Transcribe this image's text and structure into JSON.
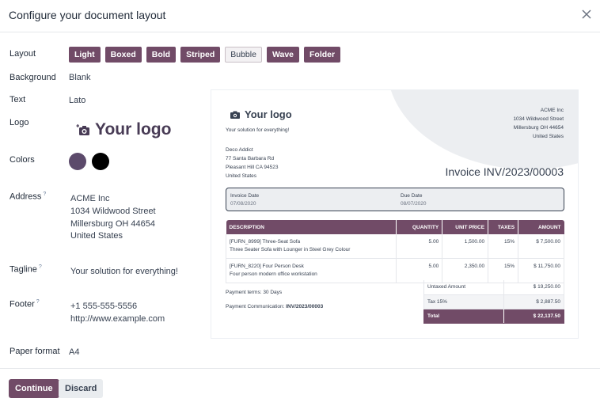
{
  "dialog": {
    "title": "Configure your document layout",
    "close_icon": "close-icon"
  },
  "fields": {
    "layout_label": "Layout",
    "layout_options": [
      "Light",
      "Boxed",
      "Bold",
      "Striped",
      "Bubble",
      "Wave",
      "Folder"
    ],
    "layout_selected": "Bubble",
    "background_label": "Background",
    "background_value": "Blank",
    "text_label": "Text",
    "text_value": "Lato",
    "logo_label": "Logo",
    "logo_text": "Your logo",
    "colors_label": "Colors",
    "colors": {
      "primary": "#5c4a6b",
      "secondary": "#000000"
    },
    "address_label": "Address",
    "address_help": "?",
    "address_lines": [
      "ACME Inc",
      "1034 Wildwood Street",
      "Millersburg OH 44654",
      "United States"
    ],
    "tagline_label": "Tagline",
    "tagline_help": "?",
    "tagline_value": "Your solution for everything!",
    "footer_label": "Footer",
    "footer_help": "?",
    "footer_lines": [
      "+1 555-555-5556",
      "http://www.example.com"
    ],
    "paper_label": "Paper format",
    "paper_value": "A4"
  },
  "preview": {
    "logo_text": "Your logo",
    "tagline": "Your solution for everything!",
    "company_lines": [
      "ACME Inc",
      "1034 Wildwood Street",
      "Millersburg OH 44654",
      "United States"
    ],
    "customer_lines": [
      "Deco Addict",
      "77 Santa Barbara Rd",
      "Pleasant Hill CA 94523",
      "United States"
    ],
    "invoice_title": "Invoice INV/2023/00003",
    "invoice_date_label": "Invoice Date",
    "invoice_date": "07/08/2020",
    "due_date_label": "Due Date",
    "due_date": "08/07/2020",
    "columns": [
      "DESCRIPTION",
      "QUANTITY",
      "UNIT PRICE",
      "TAXES",
      "AMOUNT"
    ],
    "rows": [
      {
        "code": "[FURN_8999] Three-Seat Sofa",
        "desc": "Three Seater Sofa with Lounger in Steel Grey Colour",
        "qty": "5.00",
        "price": "1,500.00",
        "tax": "15%",
        "amount": "$ 7,500.00"
      },
      {
        "code": "[FURN_8220] Four Person Desk",
        "desc": "Four person modern office workstation",
        "qty": "5.00",
        "price": "2,350.00",
        "tax": "15%",
        "amount": "$ 11,750.00"
      }
    ],
    "terms": "Payment terms: 30 Days",
    "communication_label": "Payment Communication: ",
    "communication_value": "INV/2023/00003",
    "totals": [
      {
        "label": "Untaxed Amount",
        "value": "$ 19,250.00"
      },
      {
        "label": "Tax 15%",
        "value": "$ 2,887.50"
      },
      {
        "label": "Total",
        "value": "$ 22,137.50"
      }
    ]
  },
  "actions": {
    "continue_label": "Continue",
    "discard_label": "Discard"
  },
  "theme": {
    "accent": "#714b67"
  }
}
